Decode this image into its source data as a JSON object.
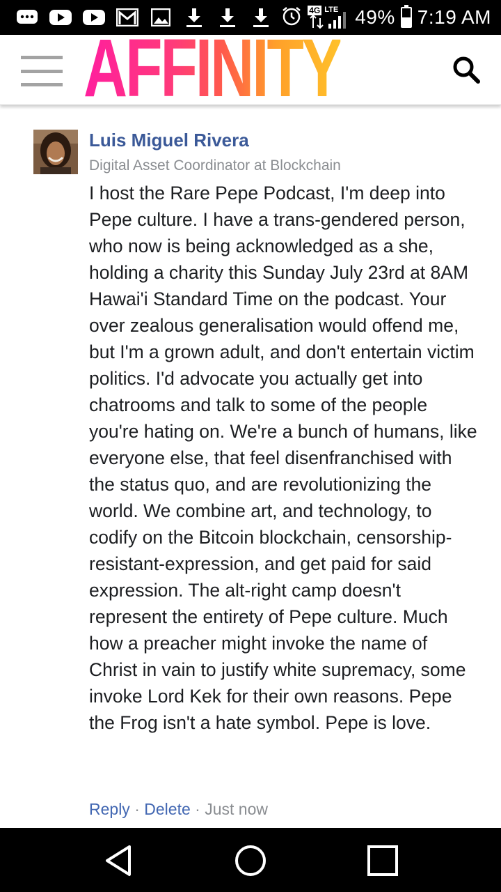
{
  "status_bar": {
    "network": "4G",
    "network_type": "LTE",
    "battery": "49%",
    "battery_level": 0.49,
    "time": "7:19 AM",
    "notification_icons": [
      "chat-icon",
      "youtube-icon",
      "youtube-icon",
      "gmail-icon",
      "image-icon",
      "download-icon",
      "download-icon",
      "download-icon"
    ]
  },
  "header": {
    "logo": "AFFINITY"
  },
  "comment": {
    "author": "Luis Miguel Rivera",
    "subtitle": "Digital Asset Coordinator at Blockchain",
    "text": "I host the Rare Pepe Podcast, I'm deep into Pepe culture. I have a trans-gendered person, who now is being acknowledged as a she, holding a charity this Sunday July 23rd at 8AM Hawai'i Standard Time on the podcast. Your over zealous generalisation would offend me, but I'm a grown adult, and don't entertain victim politics. I'd advocate you actually get into chatrooms and talk to some of the people you're hating on. We're a bunch of humans, like everyone else, that feel disenfranchised with the status quo, and are revolutionizing the world. We combine art, and technology, to codify on the Bitcoin blockchain, censorship-resistant-expression, and get paid for said expression. The alt-right camp doesn't represent the entirety of Pepe culture. Much how a preacher might invoke the name of Christ in vain to justify white supremacy, some invoke Lord Kek for their own reasons. Pepe the Frog isn't a hate symbol. Pepe is love.",
    "reply_label": "Reply",
    "separator": " · ",
    "delete_label": "Delete",
    "timestamp": "Just now"
  },
  "colors": {
    "link": "#4267b2",
    "author": "#3b5998",
    "meta": "#8a8d91",
    "logo_gradient": [
      "#ff1f9e",
      "#ffc12a"
    ]
  }
}
